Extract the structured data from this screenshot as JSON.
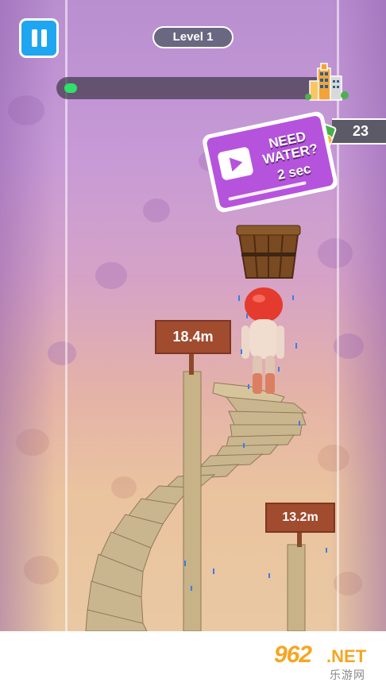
{
  "hud": {
    "level_label": "Level 1",
    "progress_fraction": 0.05,
    "progress_color": "#2fe06a",
    "money_count": "23",
    "pause_icon": "pause-icon",
    "goal_icon": "city-buildings-icon",
    "money_icon": "cash-bill-icon"
  },
  "ad": {
    "title": "NEED WATER?",
    "time": "2 sec",
    "icon": "video-play-icon"
  },
  "signs": [
    {
      "label": "18.4m"
    },
    {
      "label": "13.2m"
    }
  ],
  "watermark": {
    "main": "962",
    "suffix": ".NET",
    "sub": "乐游网"
  },
  "colors": {
    "accent_blue": "#1fa6f0",
    "ad_purple": "#b653dd",
    "sign_brown": "#a14b2f",
    "character_red": "#e53a2e"
  }
}
